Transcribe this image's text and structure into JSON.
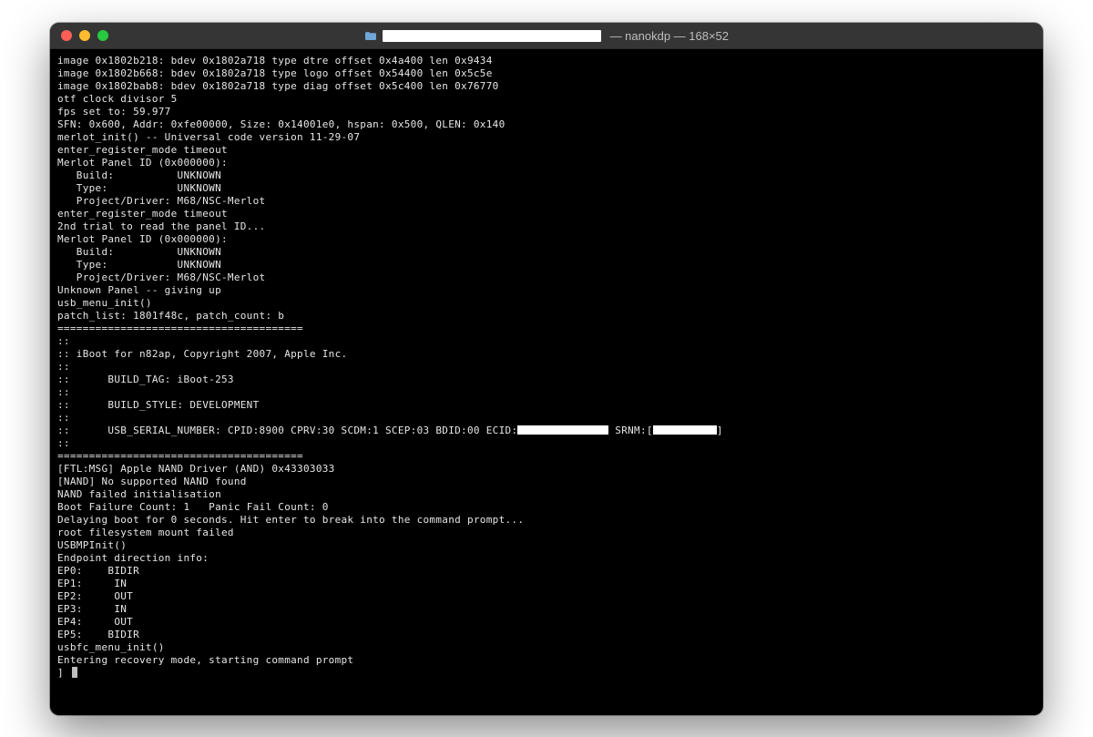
{
  "window": {
    "title_suffix": " — nanokdp — 168×52",
    "traffic_lights": [
      "close",
      "minimize",
      "zoom"
    ]
  },
  "terminal": {
    "lines": [
      "image 0x1802b218: bdev 0x1802a718 type dtre offset 0x4a400 len 0x9434",
      "image 0x1802b668: bdev 0x1802a718 type logo offset 0x54400 len 0x5c5e",
      "image 0x1802bab8: bdev 0x1802a718 type diag offset 0x5c400 len 0x76770",
      "otf clock divisor 5",
      "fps set to: 59.977",
      "SFN: 0x600, Addr: 0xfe00000, Size: 0x14001e0, hspan: 0x500, QLEN: 0x140",
      "merlot_init() -- Universal code version 11-29-07",
      "enter_register_mode timeout",
      "Merlot Panel ID (0x000000):",
      "   Build:          UNKNOWN",
      "   Type:           UNKNOWN",
      "   Project/Driver: M68/NSC-Merlot",
      "enter_register_mode timeout",
      "2nd trial to read the panel ID...",
      "Merlot Panel ID (0x000000):",
      "   Build:          UNKNOWN",
      "   Type:           UNKNOWN",
      "   Project/Driver: M68/NSC-Merlot",
      "Unknown Panel -- giving up",
      "usb_menu_init()",
      "patch_list: 1801f48c, patch_count: b",
      "",
      "",
      "=======================================",
      "::",
      ":: iBoot for n82ap, Copyright 2007, Apple Inc.",
      "::",
      "::\tBUILD_TAG: iBoot-253",
      "::",
      "::\tBUILD_STYLE: DEVELOPMENT",
      "::",
      "USB_SERIAL_LINE",
      "::",
      "=======================================",
      "",
      "[FTL:MSG] Apple NAND Driver (AND) 0x43303033",
      "[NAND] No supported NAND found",
      "NAND failed initialisation",
      "Boot Failure Count: 1\tPanic Fail Count: 0",
      "Delaying boot for 0 seconds. Hit enter to break into the command prompt...",
      "root filesystem mount failed",
      "USBMPInit()",
      "Endpoint direction info:",
      "EP0:\tBIDIR",
      "EP1:\t IN",
      "EP2:\t OUT",
      "EP3:\t IN",
      "EP4:\t OUT",
      "EP5:\tBIDIR",
      "usbfc_menu_init()",
      "Entering recovery mode, starting command prompt"
    ],
    "usb_serial_line": {
      "prefix": "::\tUSB_SERIAL_NUMBER: CPID:8900 CPRV:30 SCDM:1 SCEP:03 BDID:00 ECID:",
      "mid": " SRNM:[",
      "suffix": "]"
    },
    "prompt": "] "
  }
}
